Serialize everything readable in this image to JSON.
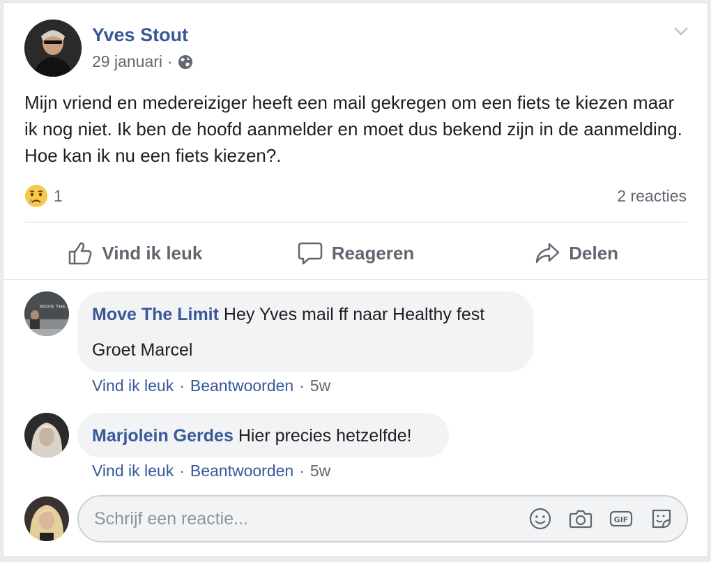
{
  "post": {
    "author": "Yves Stout",
    "date": "29 januari",
    "separator": "·",
    "text": "Mijn vriend en medereiziger heeft een mail gekregen om een fiets te kiezen maar ik nog niet. Ik ben de hoofd aanmelder en moet dus bekend zijn in de aanmelding. Hoe kan ik nu een fiets kiezen?.",
    "reaction_count": "1",
    "comment_count": "2 reacties"
  },
  "actions": {
    "like": "Vind ik leuk",
    "comment": "Reageren",
    "share": "Delen"
  },
  "comments": [
    {
      "name": "Move The Limit",
      "text_line1": "Hey Yves mail ff naar Healthy fest",
      "text_line2": "Groet Marcel",
      "like": "Vind ik leuk",
      "reply": "Beantwoorden",
      "time": "5w"
    },
    {
      "name": "Marjolein Gerdes",
      "text_line1": "Hier precies hetzelfde!",
      "like": "Vind ik leuk",
      "reply": "Beantwoorden",
      "time": "5w"
    }
  ],
  "composer": {
    "placeholder": "Schrijf een reactie..."
  },
  "icons": {
    "globe": "globe-icon",
    "chevron": "chevron-down-icon",
    "sad": "sad-reaction-icon",
    "like": "thumbs-up-icon",
    "comment": "speech-bubble-icon",
    "share": "share-arrow-icon",
    "emoji": "smiley-icon",
    "camera": "camera-icon",
    "gif": "gif-icon",
    "sticker": "sticker-icon"
  },
  "colors": {
    "link": "#385898",
    "secondary": "#616770",
    "bubble": "#f2f3f5"
  }
}
